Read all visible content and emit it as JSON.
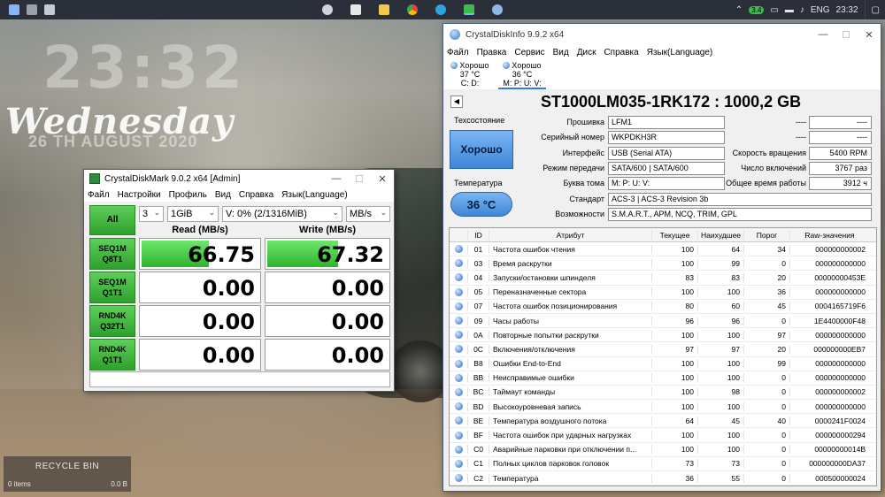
{
  "taskbar": {
    "language": "ENG",
    "time": "23:32",
    "tray_badge": "3.4"
  },
  "clock_widget": {
    "time": "23:32",
    "day": "Wednesday",
    "date": "26 TH AUGUST 2020"
  },
  "recycle_bin": {
    "title": "RECYCLE BIN",
    "items": "0 items",
    "size": "0.0 B"
  },
  "cdm": {
    "title": "CrystalDiskMark 9.0.2 x64 [Admin]",
    "menu": [
      "Файл",
      "Настройки",
      "Профиль",
      "Вид",
      "Справка",
      "Язык(Language)"
    ],
    "all_button": "All",
    "count": "3",
    "size": "1GiB",
    "drive": "V: 0% (2/1316MiB)",
    "unit": "MB/s",
    "read_header": "Read (MB/s)",
    "write_header": "Write (MB/s)",
    "tests": [
      {
        "line1": "SEQ1M",
        "line2": "Q8T1",
        "read": "66.75",
        "write": "67.32",
        "read_fill": 0.56,
        "write_fill": 0.57
      },
      {
        "line1": "SEQ1M",
        "line2": "Q1T1",
        "read": "0.00",
        "write": "0.00",
        "read_fill": 0,
        "write_fill": 0
      },
      {
        "line1": "RND4K",
        "line2": "Q32T1",
        "read": "0.00",
        "write": "0.00",
        "read_fill": 0,
        "write_fill": 0
      },
      {
        "line1": "RND4K",
        "line2": "Q1T1",
        "read": "0.00",
        "write": "0.00",
        "read_fill": 0,
        "write_fill": 0
      }
    ]
  },
  "cdi": {
    "title": "CrystalDiskInfo 9.9.2 x64",
    "menu": [
      "Файл",
      "Правка",
      "Сервис",
      "Вид",
      "Диск",
      "Справка",
      "Язык(Language)"
    ],
    "disk_tabs": [
      {
        "status": "Хорошо",
        "temp": "37 °C",
        "letters": "C: D:"
      },
      {
        "status": "Хорошо",
        "temp": "36 °C",
        "letters": "M: P: U: V:"
      }
    ],
    "model": "ST1000LM035-1RK172 : 1000,2 GB",
    "health_label": "Техсостояние",
    "health_value": "Хорошо",
    "temp_label": "Температура",
    "temp_value": "36 °C",
    "firmware_label": "Прошивка",
    "firmware": "LFM1",
    "serial_label": "Серийный номер",
    "serial": "WKPDKH3R",
    "interface_label": "Интерфейс",
    "interface": "USB (Serial ATA)",
    "transfer_label": "Режим передачи",
    "transfer": "SATA/600 | SATA/600",
    "letter_label": "Буква тома",
    "letter": "M: P: U: V:",
    "standard_label": "Стандарт",
    "standard": "ACS-3 | ACS-3 Revision 3b",
    "features_label": "Возможности",
    "features": "S.M.A.R.T., APM, NCQ, TRIM, GPL",
    "blank1_label": "----",
    "blank1": "----",
    "blank2_label": "----",
    "blank2": "----",
    "rotation_label": "Скорость вращения",
    "rotation": "5400 RPM",
    "power_count_label": "Число включений",
    "power_count": "3767 раз",
    "power_hours_label": "Общее время работы",
    "power_hours": "3912 ч",
    "smart_headers": [
      "ID",
      "Атрибут",
      "Текущее",
      "Наихудшее",
      "Порог",
      "Raw-значения"
    ],
    "smart": [
      [
        "01",
        "Частота ошибок чтения",
        "100",
        "64",
        "34",
        "000000000002"
      ],
      [
        "03",
        "Время раскрутки",
        "100",
        "99",
        "0",
        "000000000000"
      ],
      [
        "04",
        "Запуски/остановки шпинделя",
        "83",
        "83",
        "20",
        "00000000453E"
      ],
      [
        "05",
        "Переназначенные сектора",
        "100",
        "100",
        "36",
        "000000000000"
      ],
      [
        "07",
        "Частота ошибок позиционирования",
        "80",
        "60",
        "45",
        "0004165719F6"
      ],
      [
        "09",
        "Часы работы",
        "96",
        "96",
        "0",
        "1E4400000F48"
      ],
      [
        "0A",
        "Повторные попытки раскрутки",
        "100",
        "100",
        "97",
        "000000000000"
      ],
      [
        "0C",
        "Включения/отключения",
        "97",
        "97",
        "20",
        "000000000EB7"
      ],
      [
        "B8",
        "Ошибки End-to-End",
        "100",
        "100",
        "99",
        "000000000000"
      ],
      [
        "BB",
        "Неисправимые ошибки",
        "100",
        "100",
        "0",
        "000000000000"
      ],
      [
        "BC",
        "Таймаут команды",
        "100",
        "98",
        "0",
        "000000000002"
      ],
      [
        "BD",
        "Высокоуровневая запись",
        "100",
        "100",
        "0",
        "000000000000"
      ],
      [
        "BE",
        "Температура воздушного потока",
        "64",
        "45",
        "40",
        "0000241F0024"
      ],
      [
        "BF",
        "Частота ошибок при ударных нагрузках",
        "100",
        "100",
        "0",
        "000000000294"
      ],
      [
        "C0",
        "Аварийные парковки при отключении п...",
        "100",
        "100",
        "0",
        "00000000014B"
      ],
      [
        "C1",
        "Полных циклов парковок головок",
        "73",
        "73",
        "0",
        "000000000DA37"
      ],
      [
        "C2",
        "Температура",
        "36",
        "55",
        "0",
        "000500000024"
      ]
    ]
  }
}
